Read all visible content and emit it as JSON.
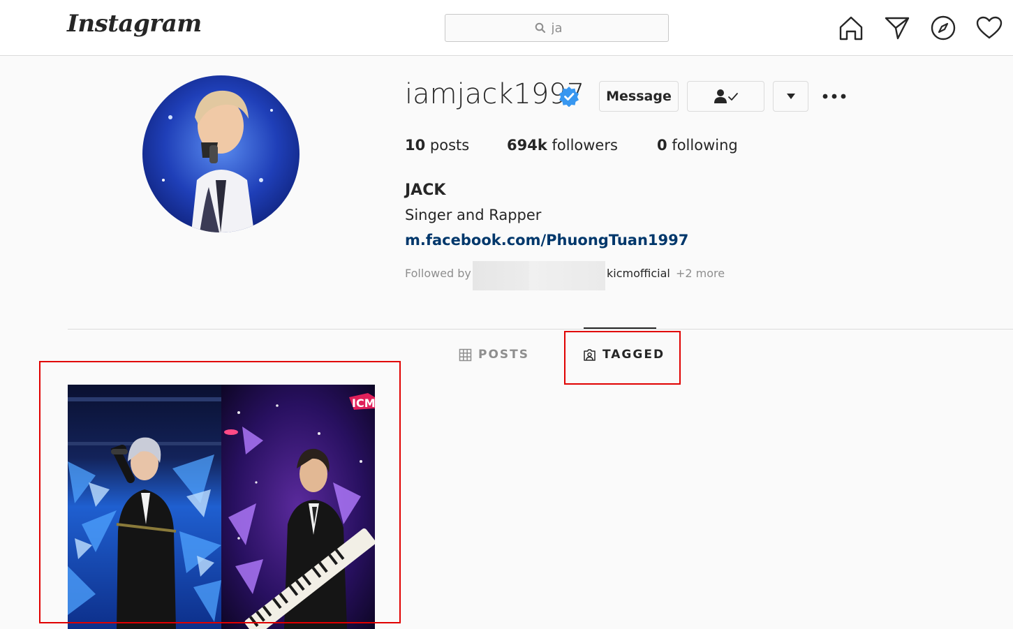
{
  "nav": {
    "logo": "Instagram",
    "search_value": "ja"
  },
  "profile": {
    "username": "iamjack1997",
    "message_label": "Message",
    "stats": {
      "posts_count": "10",
      "posts_label": "posts",
      "followers_count": "694k",
      "followers_label": "followers",
      "following_count": "0",
      "following_label": "following"
    },
    "full_name": "JACK",
    "bio": "Singer and Rapper",
    "link": "m.facebook.com/PhuongTuan1997",
    "followed_by_label": "Followed by",
    "followed_by_name": "kicmofficial",
    "followed_by_more": "+2 more"
  },
  "tabs": {
    "posts_label": "POSTS",
    "tagged_label": "TAGGED"
  },
  "post_watermark": "ICM",
  "colors": {
    "verified": "#3897f0",
    "link": "#00376b",
    "highlight": "#e00000"
  }
}
